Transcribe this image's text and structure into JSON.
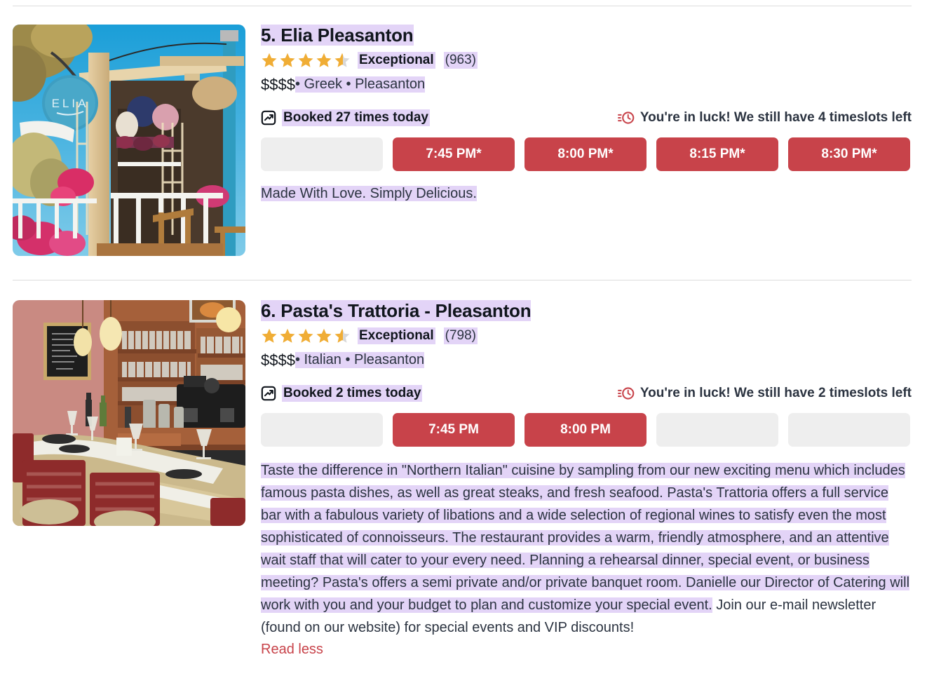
{
  "listings": [
    {
      "name": "5. Elia Pleasanton",
      "rating_stars": 4.5,
      "rating_word": "Exceptional",
      "review_count": "(963)",
      "price": "$$$$",
      "meta": " • Greek • Pleasanton",
      "booked_icon": "trending-up-icon",
      "booked_text": "Booked 27 times today",
      "luck_icon": "clock-icon",
      "luck_text": "You're in luck! We still have 4 timeslots left",
      "slots": [
        {
          "label": "",
          "state": "empty"
        },
        {
          "label": "7:45 PM*",
          "state": "filled"
        },
        {
          "label": "8:00 PM*",
          "state": "filled"
        },
        {
          "label": "8:15 PM*",
          "state": "filled"
        },
        {
          "label": "8:30 PM*",
          "state": "filled"
        }
      ],
      "tagline": "Made With Love. Simply Delicious.",
      "photo_alt": "elia-pleasanton-patio-photo"
    },
    {
      "name": "6. Pasta's Trattoria - Pleasanton",
      "rating_stars": 4.5,
      "rating_word": "Exceptional",
      "review_count": "(798)",
      "price": "$$$$",
      "meta": " • Italian • Pleasanton",
      "booked_icon": "trending-up-icon",
      "booked_text": "Booked 2 times today",
      "luck_icon": "clock-icon",
      "luck_text": "You're in luck! We still have 2 timeslots left",
      "slots": [
        {
          "label": "",
          "state": "empty"
        },
        {
          "label": "7:45 PM",
          "state": "filled"
        },
        {
          "label": "8:00 PM",
          "state": "filled"
        },
        {
          "label": "",
          "state": "empty"
        },
        {
          "label": "",
          "state": "empty"
        }
      ],
      "description_highlighted": "Taste the difference in \"Northern Italian\" cuisine by sampling from our new exciting menu which includes famous pasta dishes, as well as great steaks, and fresh seafood. Pasta's Trattoria offers a full service bar with a fabulous variety of libations and a wide selection of regional wines to satisfy even the most sophisticated of connoisseurs. The restaurant provides a warm, friendly atmosphere, and an attentive wait staff that will cater to your every need. Planning a rehearsal dinner, special event, or business meeting? Pasta's offers a semi private and/or private banquet room. Danielle our Director of Catering will work with you and your budget to plan and customize your special event.",
      "description_rest": " Join our e-mail newsletter (found on our website) for special events and VIP discounts!",
      "read_less_label": "Read less",
      "photo_alt": "pastas-trattoria-interior-photo"
    }
  ],
  "colors": {
    "slot_filled": "#c8434a",
    "slot_empty": "#eeeeee",
    "highlight": "#e3d4f7",
    "star": "#f0ad35",
    "star_empty": "#d8d8d8",
    "link": "#c8434a"
  }
}
